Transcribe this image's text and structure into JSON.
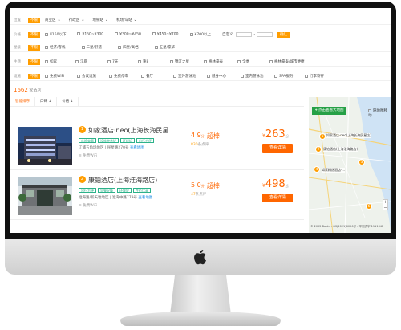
{
  "filters": {
    "location": {
      "label": "位置",
      "tag": "不限",
      "options": [
        "商业区",
        "行政区",
        "地铁站",
        "机场/车站"
      ]
    },
    "price": {
      "label": "价格",
      "tag": "不限",
      "options": [
        "¥150以下",
        "¥150~¥300",
        "¥300~¥450",
        "¥450~¥700",
        "¥700以上"
      ],
      "custom": "自定义",
      "ok": "确认"
    },
    "star": {
      "label": "星级",
      "tag": "不限",
      "options": [
        "经济/客栈",
        "三星/舒适",
        "四星/高档",
        "五星/豪华"
      ]
    },
    "theme": {
      "label": "主题",
      "tag": "不限",
      "options": [
        "如家",
        "汉庭",
        "7天",
        "速8",
        "锦江之星",
        "格林豪泰",
        "全季",
        "格林豪泰/城市便捷"
      ]
    },
    "facility": {
      "label": "设施",
      "tag": "不限",
      "options": [
        "免费WiFi",
        "会议设施",
        "免费停车",
        "餐厅",
        "室外游泳池",
        "健身中心",
        "室内游泳池",
        "SPA服务",
        "行李寄存"
      ]
    }
  },
  "result_count": {
    "number": "1662",
    "suffix": "家酒店"
  },
  "sort": [
    {
      "label": "智能排序"
    },
    {
      "label": "口碑 ↓"
    },
    {
      "label": "价格 ↕"
    }
  ],
  "hotels": [
    {
      "index": "1",
      "name": "如家酒店·neo(上海长海民星...",
      "badges": [
        "价格实惠",
        "设施完善好",
        "环境好",
        "出行方便"
      ],
      "address": "江浦五角场地区 | 民星路270号",
      "map_link": "查看地图",
      "wifi": "免费WiFi",
      "score": "4.9",
      "score_unit": "分",
      "grade": "超棒",
      "reviews_count": "830",
      "reviews_suffix": "条点评",
      "price": "263",
      "currency": "¥",
      "price_suffix": "起",
      "button": "查看详情"
    },
    {
      "index": "2",
      "name": "康铂酒店(上海淮海路店)",
      "badges": [
        "出行方便",
        "早餐好棒",
        "环境好",
        "性价比高"
      ],
      "address": "淮海路/新天地地区 | 淮海中路779号",
      "map_link": "查看地图",
      "wifi": "免费WiFi",
      "score": "5.0",
      "score_unit": "分",
      "grade": "超棒",
      "reviews_count": "47",
      "reviews_suffix": "条点评",
      "price": "498",
      "currency": "¥",
      "price_suffix": "起",
      "button": "查看详情"
    }
  ],
  "map": {
    "button": "点击查看大地图",
    "toggle": "随地图移动",
    "pins": [
      {
        "num": "1",
        "label": "如家酒店·neo(上海长海民星店)"
      },
      {
        "num": "2",
        "label": "康铂酒店(上海淮海路店)"
      },
      {
        "num": "3",
        "label": ""
      },
      {
        "num": "4",
        "label": "如家精选酒店·..."
      },
      {
        "num": "6",
        "label": ""
      }
    ],
    "footer": "© 2022 Baidu - GS(2021)6026号 - 甲测资字 1111342"
  },
  "colors": {
    "accent": "#ff6600",
    "tag": "#ff9d00",
    "green": "#26a046",
    "badge": "#2db28a",
    "link": "#1a8de6"
  }
}
